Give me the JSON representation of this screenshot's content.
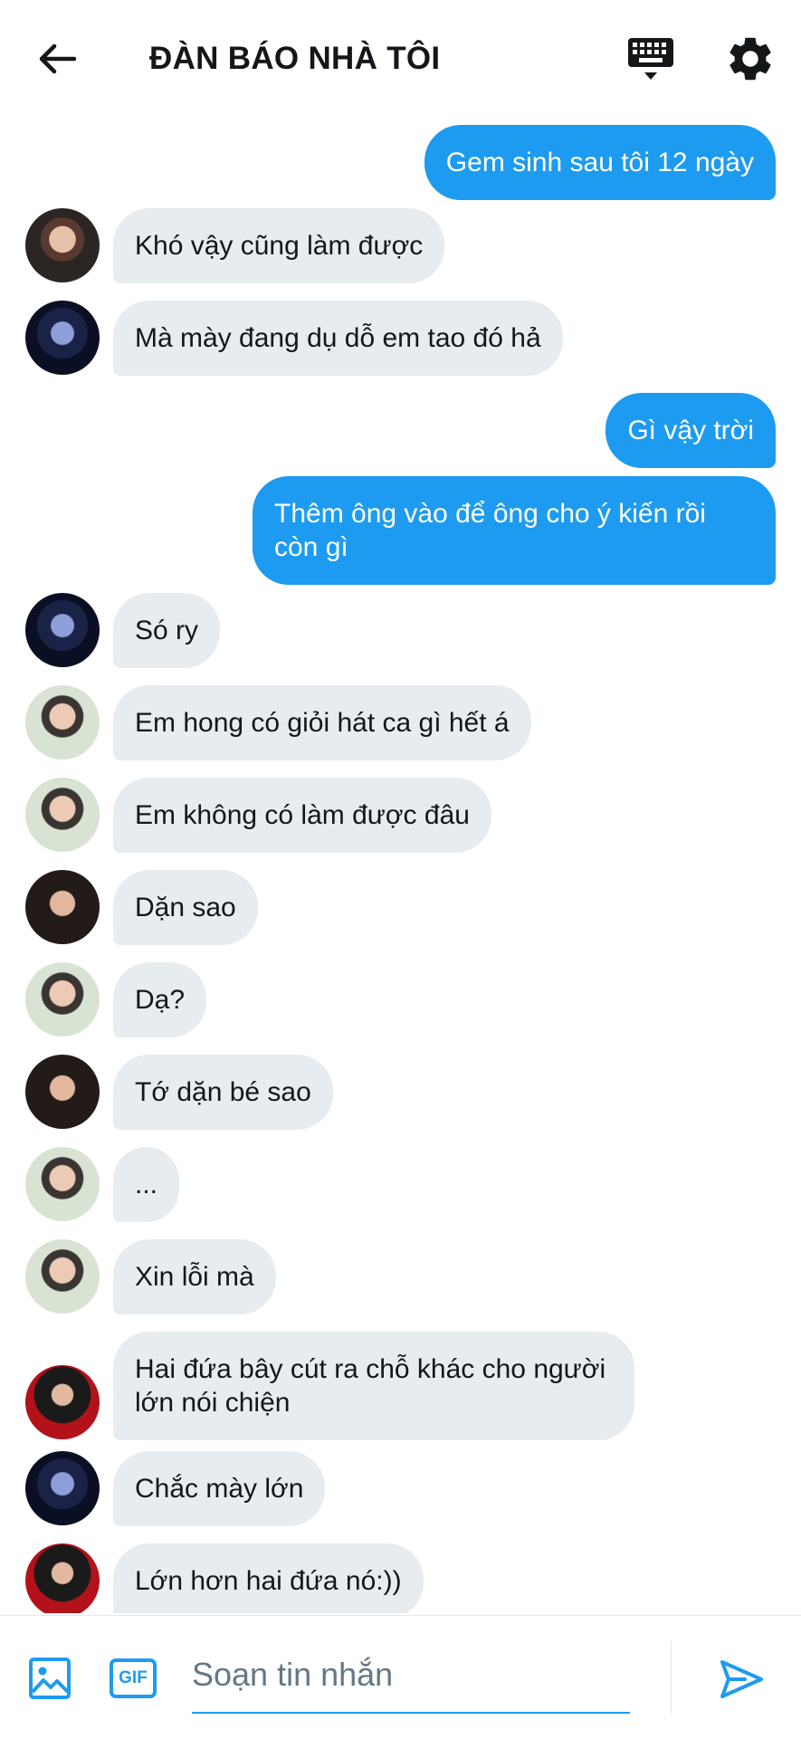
{
  "header": {
    "title": "ĐÀN BÁO NHÀ TÔI",
    "back_icon": "arrow-left-icon",
    "keyboard_icon": "keyboard-icon",
    "settings_icon": "gear-icon"
  },
  "colors": {
    "accent": "#1d9bf0",
    "incoming_bubble": "#e6ecf0",
    "text": "#14171a",
    "placeholder": "#657786"
  },
  "messages": [
    {
      "direction": "out",
      "text": "Gem sinh sau tôi 12 ngày"
    },
    {
      "direction": "in",
      "avatar": "avatar-a",
      "text": "Khó vậy cũng làm được"
    },
    {
      "direction": "in",
      "avatar": "avatar-b",
      "text": "Mà mày đang dụ dỗ em tao đó hả"
    },
    {
      "direction": "out",
      "text": "Gì vậy trời"
    },
    {
      "direction": "out",
      "text": "Thêm ông vào để ông cho ý kiến rồi còn gì"
    },
    {
      "direction": "in",
      "avatar": "avatar-b",
      "text": "Só ry"
    },
    {
      "direction": "in",
      "avatar": "avatar-c",
      "text": "Em hong có giỏi hát ca gì hết á"
    },
    {
      "direction": "in",
      "avatar": "avatar-c",
      "text": "Em không có làm được đâu"
    },
    {
      "direction": "in",
      "avatar": "avatar-d",
      "text": "Dặn sao"
    },
    {
      "direction": "in",
      "avatar": "avatar-c",
      "text": "Dạ?"
    },
    {
      "direction": "in",
      "avatar": "avatar-d",
      "text": "Tớ dặn bé sao"
    },
    {
      "direction": "in",
      "avatar": "avatar-c",
      "text": "..."
    },
    {
      "direction": "in",
      "avatar": "avatar-c",
      "text": "Xin lỗi mà"
    },
    {
      "direction": "in",
      "avatar": "avatar-e",
      "text": "Hai đứa bây cút ra chỗ khác cho người lớn nói chiện"
    },
    {
      "direction": "in",
      "avatar": "avatar-b",
      "text": "Chắc mày lớn"
    },
    {
      "direction": "in",
      "avatar": "avatar-e",
      "text": "Lớn hơn hai đứa nó:))"
    }
  ],
  "composer": {
    "placeholder": "Soạn tin nhắn",
    "value": "",
    "image_icon": "image-icon",
    "gif_label": "GIF",
    "send_icon": "send-icon"
  }
}
